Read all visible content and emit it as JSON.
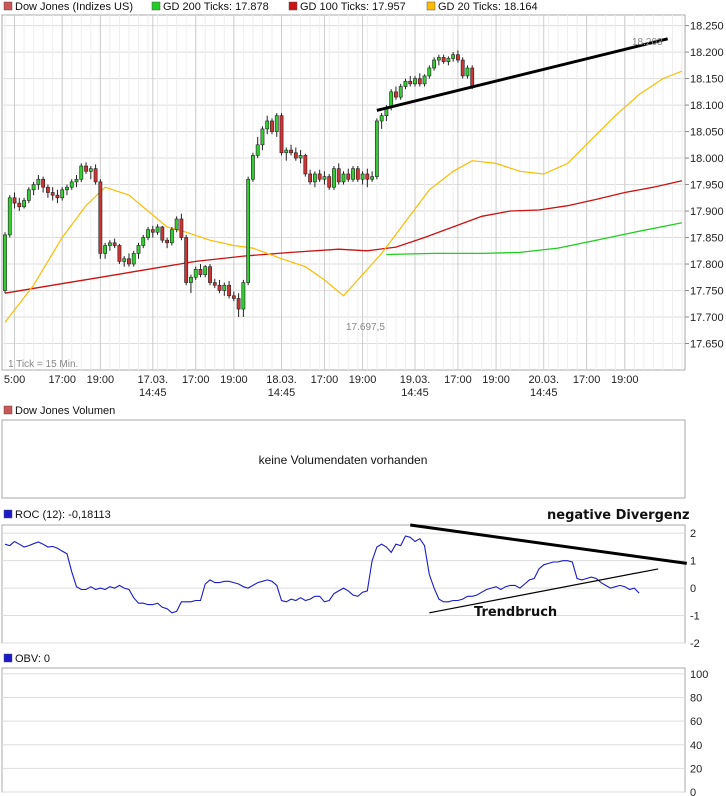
{
  "colors": {
    "candle_up": "#33cc33",
    "candle_down": "#cc3333",
    "gd200": "#22cc22",
    "gd100": "#cc1111",
    "gd20": "#ffbb00",
    "roc": "#1a1acc",
    "grid": "#dddddd",
    "trendline": "#000000"
  },
  "legend": {
    "main": "Dow Jones (Indizes US)",
    "gd200": "GD 200 Ticks: 17.878",
    "gd100": "GD 100 Ticks: 17.957",
    "gd20": "GD 20 Ticks: 18.164"
  },
  "annotations": {
    "tick_info": "1 Tick = 15 Min.",
    "low_label": "17.697,5",
    "high_label": "18.203",
    "divergence": "negative Divergenz",
    "trendbreak": "Trendbruch"
  },
  "volume": {
    "label": "Dow Jones Volumen",
    "message": "keine Volumendaten vorhanden"
  },
  "roc": {
    "label": "ROC (12): -0,18113"
  },
  "obv": {
    "label": "OBV: 0"
  },
  "chart_data": [
    {
      "type": "candlestick",
      "ylim": [
        17600,
        18270
      ],
      "x_ticks": [
        {
          "label": "5:00",
          "sub": "",
          "x": 2
        },
        {
          "label": "17:00",
          "sub": "",
          "x": 12
        },
        {
          "label": "19:00",
          "sub": "",
          "x": 20
        },
        {
          "label": "17.03.",
          "sub": "14:45",
          "x": 31
        },
        {
          "label": "17:00",
          "sub": "",
          "x": 40
        },
        {
          "label": "19:00",
          "sub": "",
          "x": 48
        },
        {
          "label": "18.03.",
          "sub": "14:45",
          "x": 58
        },
        {
          "label": "17:00",
          "sub": "",
          "x": 67
        },
        {
          "label": "19:00",
          "sub": "",
          "x": 75
        },
        {
          "label": "19.03.",
          "sub": "14:45",
          "x": 86
        },
        {
          "label": "17:00",
          "sub": "",
          "x": 95
        },
        {
          "label": "19:00",
          "sub": "",
          "x": 103
        },
        {
          "label": "20.03.",
          "sub": "14:45",
          "x": 113
        },
        {
          "label": "17:00",
          "sub": "",
          "x": 122
        },
        {
          "label": "19:00",
          "sub": "",
          "x": 130
        }
      ],
      "y_ticks": [
        17650,
        17700,
        17750,
        17800,
        17850,
        17900,
        17950,
        18000,
        18050,
        18100,
        18150,
        18200,
        18250
      ],
      "candles": [
        [
          17750,
          17860,
          17745,
          17855
        ],
        [
          17855,
          17930,
          17850,
          17925
        ],
        [
          17925,
          17935,
          17905,
          17915
        ],
        [
          17915,
          17925,
          17900,
          17908
        ],
        [
          17908,
          17925,
          17905,
          17920
        ],
        [
          17920,
          17945,
          17915,
          17940
        ],
        [
          17940,
          17955,
          17930,
          17950
        ],
        [
          17950,
          17968,
          17940,
          17960
        ],
        [
          17960,
          17965,
          17935,
          17945
        ],
        [
          17945,
          17950,
          17925,
          17935
        ],
        [
          17935,
          17945,
          17920,
          17930
        ],
        [
          17930,
          17940,
          17915,
          17925
        ],
        [
          17925,
          17945,
          17920,
          17940
        ],
        [
          17940,
          17950,
          17930,
          17945
        ],
        [
          17945,
          17960,
          17940,
          17955
        ],
        [
          17955,
          17968,
          17945,
          17960
        ],
        [
          17960,
          17990,
          17955,
          17985
        ],
        [
          17985,
          17992,
          17970,
          17975
        ],
        [
          17975,
          17985,
          17960,
          17980
        ],
        [
          17980,
          17988,
          17950,
          17955
        ],
        [
          17955,
          17960,
          17810,
          17820
        ],
        [
          17820,
          17840,
          17810,
          17835
        ],
        [
          17835,
          17845,
          17825,
          17840
        ],
        [
          17840,
          17848,
          17830,
          17835
        ],
        [
          17835,
          17838,
          17800,
          17805
        ],
        [
          17805,
          17815,
          17795,
          17810
        ],
        [
          17810,
          17820,
          17795,
          17800
        ],
        [
          17800,
          17825,
          17795,
          17820
        ],
        [
          17820,
          17840,
          17810,
          17835
        ],
        [
          17835,
          17855,
          17830,
          17850
        ],
        [
          17850,
          17870,
          17845,
          17865
        ],
        [
          17865,
          17872,
          17850,
          17860
        ],
        [
          17860,
          17875,
          17855,
          17870
        ],
        [
          17870,
          17872,
          17840,
          17845
        ],
        [
          17845,
          17850,
          17830,
          17840
        ],
        [
          17840,
          17870,
          17835,
          17865
        ],
        [
          17865,
          17890,
          17860,
          17885
        ],
        [
          17885,
          17895,
          17845,
          17850
        ],
        [
          17850,
          17855,
          17760,
          17765
        ],
        [
          17765,
          17780,
          17745,
          17775
        ],
        [
          17775,
          17795,
          17770,
          17790
        ],
        [
          17790,
          17800,
          17775,
          17780
        ],
        [
          17780,
          17798,
          17775,
          17795
        ],
        [
          17795,
          17800,
          17760,
          17765
        ],
        [
          17765,
          17772,
          17755,
          17760
        ],
        [
          17760,
          17770,
          17745,
          17750
        ],
        [
          17750,
          17765,
          17740,
          17760
        ],
        [
          17760,
          17768,
          17735,
          17740
        ],
        [
          17740,
          17748,
          17730,
          17735
        ],
        [
          17735,
          17745,
          17700,
          17715
        ],
        [
          17715,
          17770,
          17700,
          17765
        ],
        [
          17765,
          17965,
          17760,
          17960
        ],
        [
          17960,
          18010,
          17955,
          18005
        ],
        [
          18005,
          18040,
          18000,
          18025
        ],
        [
          18025,
          18060,
          18015,
          18055
        ],
        [
          18055,
          18080,
          18045,
          18070
        ],
        [
          18070,
          18075,
          18045,
          18050
        ],
        [
          18050,
          18085,
          18040,
          18080
        ],
        [
          18080,
          18085,
          18005,
          18010
        ],
        [
          18010,
          18020,
          17995,
          18015
        ],
        [
          18015,
          18025,
          18005,
          18010
        ],
        [
          18010,
          18020,
          17995,
          18000
        ],
        [
          18000,
          18015,
          17990,
          18005
        ],
        [
          18005,
          18008,
          17965,
          17970
        ],
        [
          17970,
          17978,
          17950,
          17955
        ],
        [
          17955,
          17975,
          17945,
          17970
        ],
        [
          17970,
          17978,
          17955,
          17960
        ],
        [
          17960,
          17975,
          17950,
          17965
        ],
        [
          17965,
          17970,
          17940,
          17945
        ],
        [
          17945,
          17985,
          17940,
          17980
        ],
        [
          17980,
          17990,
          17950,
          17955
        ],
        [
          17955,
          17975,
          17950,
          17970
        ],
        [
          17970,
          17980,
          17955,
          17960
        ],
        [
          17960,
          17985,
          17955,
          17980
        ],
        [
          17980,
          17985,
          17955,
          17960
        ],
        [
          17960,
          17975,
          17950,
          17970
        ],
        [
          17970,
          17980,
          17945,
          17960
        ],
        [
          17960,
          17975,
          17955,
          17965
        ],
        [
          17965,
          18075,
          17960,
          18070
        ],
        [
          18070,
          18085,
          18055,
          18080
        ],
        [
          18080,
          18100,
          18070,
          18095
        ],
        [
          18095,
          18130,
          18090,
          18125
        ],
        [
          18125,
          18135,
          18110,
          18115
        ],
        [
          18115,
          18140,
          18110,
          18135
        ],
        [
          18135,
          18150,
          18130,
          18145
        ],
        [
          18145,
          18155,
          18135,
          18140
        ],
        [
          18140,
          18155,
          18135,
          18150
        ],
        [
          18150,
          18160,
          18135,
          18140
        ],
        [
          18140,
          18158,
          18135,
          18155
        ],
        [
          18155,
          18175,
          18150,
          18170
        ],
        [
          18170,
          18190,
          18165,
          18185
        ],
        [
          18185,
          18195,
          18175,
          18190
        ],
        [
          18190,
          18195,
          18178,
          18182
        ],
        [
          18182,
          18192,
          18175,
          18188
        ],
        [
          18188,
          18200,
          18182,
          18195
        ],
        [
          18195,
          18203,
          18180,
          18185
        ],
        [
          18185,
          18190,
          18150,
          18155
        ],
        [
          18155,
          18175,
          18150,
          18170
        ],
        [
          18170,
          18175,
          18130,
          18135
        ]
      ],
      "sma20": [
        [
          0,
          17690
        ],
        [
          6,
          17760
        ],
        [
          12,
          17850
        ],
        [
          17,
          17910
        ],
        [
          21,
          17945
        ],
        [
          26,
          17930
        ],
        [
          30,
          17900
        ],
        [
          34,
          17870
        ],
        [
          38,
          17860
        ],
        [
          43,
          17845
        ],
        [
          48,
          17835
        ],
        [
          52,
          17830
        ],
        [
          58,
          17810
        ],
        [
          63,
          17795
        ],
        [
          67,
          17770
        ],
        [
          71,
          17740
        ],
        [
          74,
          17770
        ],
        [
          79,
          17820
        ],
        [
          84,
          17880
        ],
        [
          89,
          17940
        ],
        [
          94,
          17975
        ],
        [
          98,
          17995
        ],
        [
          103,
          17990
        ],
        [
          108,
          17975
        ],
        [
          113,
          17970
        ],
        [
          118,
          17990
        ],
        [
          123,
          18035
        ],
        [
          128,
          18080
        ],
        [
          133,
          18120
        ],
        [
          138,
          18150
        ],
        [
          142,
          18164
        ]
      ],
      "sma100": [
        [
          0,
          17745
        ],
        [
          10,
          17760
        ],
        [
          20,
          17775
        ],
        [
          30,
          17790
        ],
        [
          40,
          17805
        ],
        [
          50,
          17815
        ],
        [
          60,
          17822
        ],
        [
          70,
          17828
        ],
        [
          76,
          17825
        ],
        [
          82,
          17832
        ],
        [
          88,
          17850
        ],
        [
          94,
          17870
        ],
        [
          100,
          17890
        ],
        [
          106,
          17900
        ],
        [
          112,
          17902
        ],
        [
          118,
          17910
        ],
        [
          124,
          17922
        ],
        [
          130,
          17935
        ],
        [
          136,
          17945
        ],
        [
          142,
          17957
        ]
      ],
      "sma200": [
        [
          80,
          17818
        ],
        [
          90,
          17820
        ],
        [
          100,
          17820
        ],
        [
          108,
          17822
        ],
        [
          116,
          17830
        ],
        [
          124,
          17845
        ],
        [
          132,
          17860
        ],
        [
          142,
          17878
        ]
      ],
      "trendlines": [
        [
          78,
          18090,
          139,
          18225
        ]
      ]
    },
    {
      "type": "line",
      "ylim": [
        -2,
        2.3
      ],
      "y_ticks": [
        -2,
        -1,
        0,
        1,
        2
      ],
      "series": [
        {
          "values": [
            1.6,
            1.55,
            1.7,
            1.6,
            1.5,
            1.55,
            1.62,
            1.68,
            1.6,
            1.5,
            1.52,
            1.45,
            1.35,
            1.25,
            0.6,
            0.05,
            -0.05,
            -0.05,
            0.05,
            -0.05,
            0.0,
            -0.05,
            0.05,
            0.0,
            0.1,
            0.0,
            -0.05,
            -0.35,
            -0.55,
            -0.55,
            -0.6,
            -0.6,
            -0.55,
            -0.7,
            -0.75,
            -0.9,
            -0.85,
            -0.5,
            -0.5,
            -0.5,
            -0.45,
            -0.45,
            0.15,
            0.3,
            0.2,
            0.2,
            0.25,
            0.25,
            0.2,
            0.15,
            0.05,
            0.0,
            0.1,
            0.2,
            0.25,
            0.3,
            0.25,
            0.1,
            -0.45,
            -0.5,
            -0.4,
            -0.45,
            -0.35,
            -0.45,
            -0.4,
            -0.3,
            -0.3,
            -0.5,
            -0.45,
            -0.2,
            -0.1,
            0.0,
            -0.1,
            -0.25,
            -0.3,
            -0.15,
            -0.1,
            1.0,
            1.5,
            1.6,
            1.5,
            1.3,
            1.6,
            1.55,
            1.9,
            1.85,
            1.7,
            1.8,
            1.55,
            0.5,
            0.0,
            -0.4,
            -0.5,
            -0.5,
            -0.45,
            -0.45,
            -0.4,
            -0.3,
            -0.3,
            -0.25,
            -0.15,
            -0.05,
            0.0,
            0.05,
            -0.05,
            0.05,
            0.1,
            0.1,
            0.0,
            0.15,
            0.3,
            0.35,
            0.7,
            0.85,
            0.9,
            0.95,
            0.95,
            1.0,
            1.0,
            0.95,
            0.35,
            0.3,
            0.35,
            0.4,
            0.35,
            0.2,
            0.1,
            0.0,
            0.05,
            0.1,
            0.05,
            -0.05,
            0.0,
            -0.18
          ]
        }
      ],
      "trendlines": [
        [
          85,
          2.3,
          143,
          0.9
        ],
        [
          89,
          -0.9,
          137,
          0.7
        ]
      ]
    },
    {
      "type": "line",
      "ylim": [
        0,
        105
      ],
      "y_ticks": [
        0,
        20,
        40,
        60,
        80,
        100
      ],
      "series": []
    }
  ]
}
